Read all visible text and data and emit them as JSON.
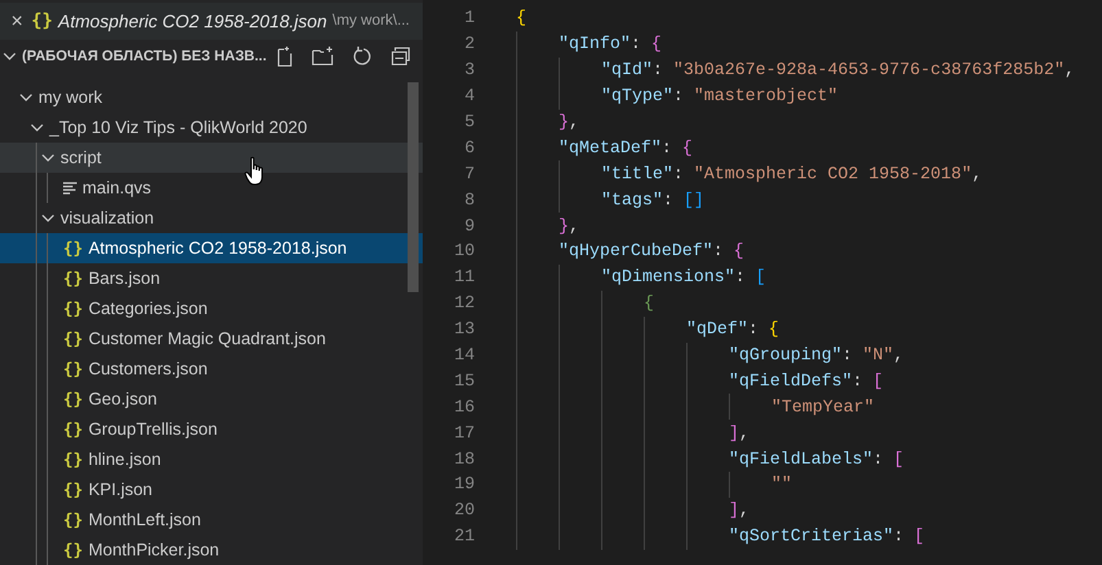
{
  "open_editor": {
    "close": "×",
    "icon": "{}",
    "name": "Atmospheric CO2 1958-2018.json",
    "path": "\\my work\\..."
  },
  "explorer": {
    "title": "(РАБОЧАЯ ОБЛАСТЬ) БЕЗ НАЗВ...",
    "tree": [
      {
        "kind": "folder",
        "label": "my work",
        "expanded": true,
        "selected": false,
        "hovered": false,
        "children": [
          {
            "kind": "folder",
            "label": "_Top 10 Viz Tips - QlikWorld 2020",
            "expanded": true,
            "selected": false,
            "hovered": false,
            "children": [
              {
                "kind": "folder",
                "label": "script",
                "expanded": true,
                "selected": false,
                "hovered": true,
                "children": [
                  {
                    "kind": "qvs",
                    "label": "main.qvs",
                    "selected": false,
                    "hovered": false
                  }
                ]
              },
              {
                "kind": "folder",
                "label": "visualization",
                "expanded": true,
                "selected": false,
                "hovered": false,
                "children": [
                  {
                    "kind": "json",
                    "icon": "{}",
                    "label": "Atmospheric CO2 1958-2018.json",
                    "selected": true,
                    "hovered": false
                  },
                  {
                    "kind": "json",
                    "icon": "{}",
                    "label": "Bars.json",
                    "selected": false,
                    "hovered": false
                  },
                  {
                    "kind": "json",
                    "icon": "{}",
                    "label": "Categories.json",
                    "selected": false,
                    "hovered": false
                  },
                  {
                    "kind": "json",
                    "icon": "{}",
                    "label": "Customer Magic Quadrant.json",
                    "selected": false,
                    "hovered": false
                  },
                  {
                    "kind": "json",
                    "icon": "{}",
                    "label": "Customers.json",
                    "selected": false,
                    "hovered": false
                  },
                  {
                    "kind": "json",
                    "icon": "{}",
                    "label": "Geo.json",
                    "selected": false,
                    "hovered": false
                  },
                  {
                    "kind": "json",
                    "icon": "{}",
                    "label": "GroupTrellis.json",
                    "selected": false,
                    "hovered": false
                  },
                  {
                    "kind": "json",
                    "icon": "{}",
                    "label": "hline.json",
                    "selected": false,
                    "hovered": false
                  },
                  {
                    "kind": "json",
                    "icon": "{}",
                    "label": "KPI.json",
                    "selected": false,
                    "hovered": false
                  },
                  {
                    "kind": "json",
                    "icon": "{}",
                    "label": "MonthLeft.json",
                    "selected": false,
                    "hovered": false
                  },
                  {
                    "kind": "json",
                    "icon": "{}",
                    "label": "MonthPicker.json",
                    "selected": false,
                    "hovered": false
                  }
                ]
              }
            ]
          }
        ]
      }
    ]
  },
  "editor": {
    "lines": [
      {
        "number": "1",
        "tokens": [
          {
            "kind": "bracket",
            "text": "{",
            "color": "#ffd700"
          }
        ],
        "children": [
          {
            "number": "2",
            "tokens": [
              {
                "kind": "key",
                "text": "\"qInfo\""
              },
              {
                "kind": "punct",
                "text": ": "
              },
              {
                "kind": "bracket",
                "text": "{",
                "color": "#da70d6"
              }
            ],
            "children": [
              {
                "number": "3",
                "tokens": [
                  {
                    "kind": "key",
                    "text": "\"qId\""
                  },
                  {
                    "kind": "punct",
                    "text": ": "
                  },
                  {
                    "kind": "string",
                    "text": "\"3b0a267e-928a-4653-9776-c38763f285b2\""
                  },
                  {
                    "kind": "punct",
                    "text": ","
                  }
                ]
              },
              {
                "number": "4",
                "tokens": [
                  {
                    "kind": "key",
                    "text": "\"qType\""
                  },
                  {
                    "kind": "punct",
                    "text": ": "
                  },
                  {
                    "kind": "string",
                    "text": "\"masterobject\""
                  }
                ]
              }
            ]
          },
          {
            "number": "5",
            "tokens": [
              {
                "kind": "bracket",
                "text": "}",
                "color": "#da70d6"
              },
              {
                "kind": "punct",
                "text": ","
              }
            ]
          },
          {
            "number": "6",
            "tokens": [
              {
                "kind": "key",
                "text": "\"qMetaDef\""
              },
              {
                "kind": "punct",
                "text": ": "
              },
              {
                "kind": "bracket",
                "text": "{",
                "color": "#da70d6"
              }
            ],
            "children": [
              {
                "number": "7",
                "tokens": [
                  {
                    "kind": "key",
                    "text": "\"title\""
                  },
                  {
                    "kind": "punct",
                    "text": ": "
                  },
                  {
                    "kind": "string",
                    "text": "\"Atmospheric CO2 1958-2018\""
                  },
                  {
                    "kind": "punct",
                    "text": ","
                  }
                ]
              },
              {
                "number": "8",
                "tokens": [
                  {
                    "kind": "key",
                    "text": "\"tags\""
                  },
                  {
                    "kind": "punct",
                    "text": ": "
                  },
                  {
                    "kind": "bracket",
                    "text": "[]",
                    "color": "#179fff"
                  }
                ]
              }
            ]
          },
          {
            "number": "9",
            "tokens": [
              {
                "kind": "bracket",
                "text": "}",
                "color": "#da70d6"
              },
              {
                "kind": "punct",
                "text": ","
              }
            ]
          },
          {
            "number": "10",
            "tokens": [
              {
                "kind": "key",
                "text": "\"qHyperCubeDef\""
              },
              {
                "kind": "punct",
                "text": ": "
              },
              {
                "kind": "bracket",
                "text": "{",
                "color": "#da70d6"
              }
            ],
            "children": [
              {
                "number": "11",
                "tokens": [
                  {
                    "kind": "key",
                    "text": "\"qDimensions\""
                  },
                  {
                    "kind": "punct",
                    "text": ": "
                  },
                  {
                    "kind": "bracket",
                    "text": "[",
                    "color": "#179fff"
                  }
                ],
                "children": [
                  {
                    "number": "12",
                    "tokens": [
                      {
                        "kind": "bracket",
                        "text": "{",
                        "color": "#6a9955"
                      }
                    ],
                    "children": [
                      {
                        "number": "13",
                        "tokens": [
                          {
                            "kind": "key",
                            "text": "\"qDef\""
                          },
                          {
                            "kind": "punct",
                            "text": ": "
                          },
                          {
                            "kind": "bracket",
                            "text": "{",
                            "color": "#ffd700"
                          }
                        ],
                        "children": [
                          {
                            "number": "14",
                            "tokens": [
                              {
                                "kind": "key",
                                "text": "\"qGrouping\""
                              },
                              {
                                "kind": "punct",
                                "text": ": "
                              },
                              {
                                "kind": "string",
                                "text": "\"N\""
                              },
                              {
                                "kind": "punct",
                                "text": ","
                              }
                            ]
                          },
                          {
                            "number": "15",
                            "tokens": [
                              {
                                "kind": "key",
                                "text": "\"qFieldDefs\""
                              },
                              {
                                "kind": "punct",
                                "text": ": "
                              },
                              {
                                "kind": "bracket",
                                "text": "[",
                                "color": "#da70d6"
                              }
                            ],
                            "children": [
                              {
                                "number": "16",
                                "tokens": [
                                  {
                                    "kind": "string",
                                    "text": "\"TempYear\""
                                  }
                                ]
                              }
                            ]
                          },
                          {
                            "number": "17",
                            "tokens": [
                              {
                                "kind": "bracket",
                                "text": "]",
                                "color": "#da70d6"
                              },
                              {
                                "kind": "punct",
                                "text": ","
                              }
                            ]
                          },
                          {
                            "number": "18",
                            "tokens": [
                              {
                                "kind": "key",
                                "text": "\"qFieldLabels\""
                              },
                              {
                                "kind": "punct",
                                "text": ": "
                              },
                              {
                                "kind": "bracket",
                                "text": "[",
                                "color": "#da70d6"
                              }
                            ],
                            "children": [
                              {
                                "number": "19",
                                "tokens": [
                                  {
                                    "kind": "string",
                                    "text": "\"\""
                                  }
                                ]
                              }
                            ]
                          },
                          {
                            "number": "20",
                            "tokens": [
                              {
                                "kind": "bracket",
                                "text": "]",
                                "color": "#da70d6"
                              },
                              {
                                "kind": "punct",
                                "text": ","
                              }
                            ]
                          },
                          {
                            "number": "21",
                            "tokens": [
                              {
                                "kind": "key",
                                "text": "\"qSortCriterias\""
                              },
                              {
                                "kind": "punct",
                                "text": ": "
                              },
                              {
                                "kind": "bracket",
                                "text": "[",
                                "color": "#da70d6"
                              }
                            ]
                          }
                        ]
                      }
                    ]
                  }
                ]
              }
            ]
          }
        ]
      }
    ]
  }
}
